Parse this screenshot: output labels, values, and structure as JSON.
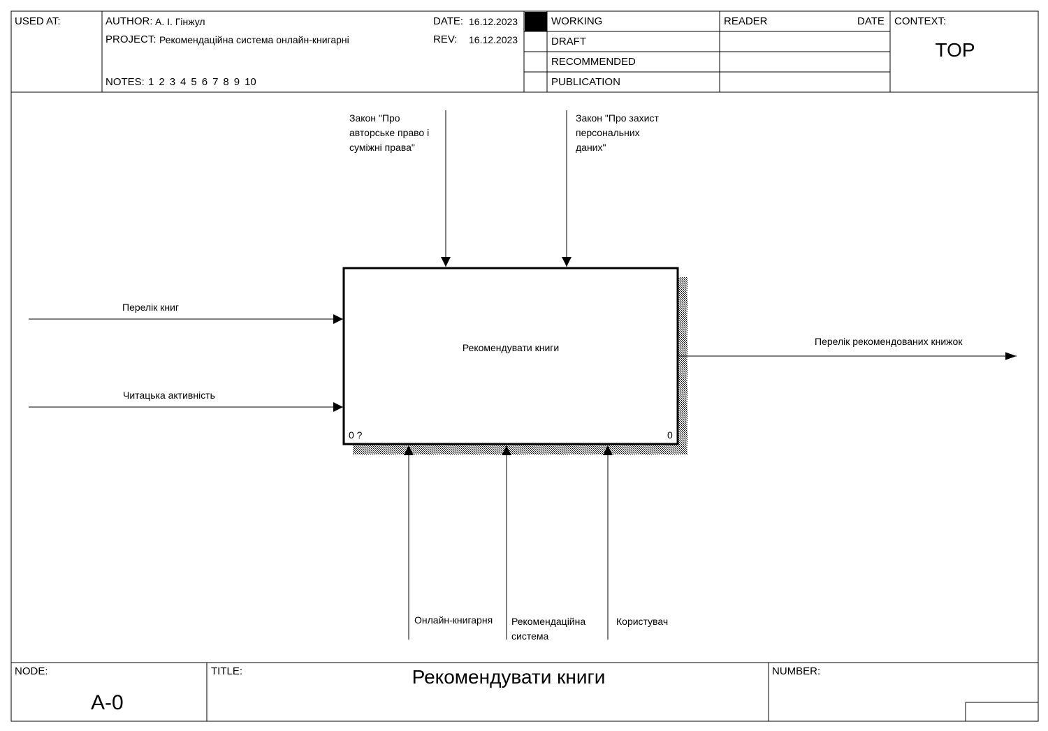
{
  "header": {
    "used_at_label": "USED AT:",
    "author_label": "AUTHOR:",
    "author": "А. І. Гінжул",
    "project_label": "PROJECT:",
    "project": "Рекомендаційна система онлайн-книгарні",
    "date_label": "DATE:",
    "date": "16.12.2023",
    "rev_label": "REV:",
    "rev": "16.12.2023",
    "notes_label": "NOTES:",
    "notes": [
      "1",
      "2",
      "3",
      "4",
      "5",
      "6",
      "7",
      "8",
      "9",
      "10"
    ],
    "status": [
      "WORKING",
      "DRAFT",
      "RECOMMENDED",
      "PUBLICATION"
    ],
    "status_selected": "WORKING",
    "reader_label": "READER",
    "reader_date_label": "DATE",
    "context_label": "CONTEXT:",
    "context_value": "TOP"
  },
  "diagram": {
    "activity": {
      "name": "Рекомендувати книги",
      "cost_label": "0 ?",
      "number": "0"
    },
    "controls": [
      "Закон \"Про\nавторське право і\nсуміжні права\"",
      "Закон \"Про захист\nперсональних\nданих\""
    ],
    "inputs": [
      "Перелік книг",
      "Читацька активність"
    ],
    "outputs": [
      "Перелік рекомендованих книжок"
    ],
    "mechanisms": [
      "Онлайн-книгарня",
      "Рекомендаційна\nсистема",
      "Користувач"
    ]
  },
  "footer": {
    "node_label": "NODE:",
    "node": "A-0",
    "title_label": "TITLE:",
    "title": "Рекомендувати книги",
    "number_label": "NUMBER:"
  }
}
